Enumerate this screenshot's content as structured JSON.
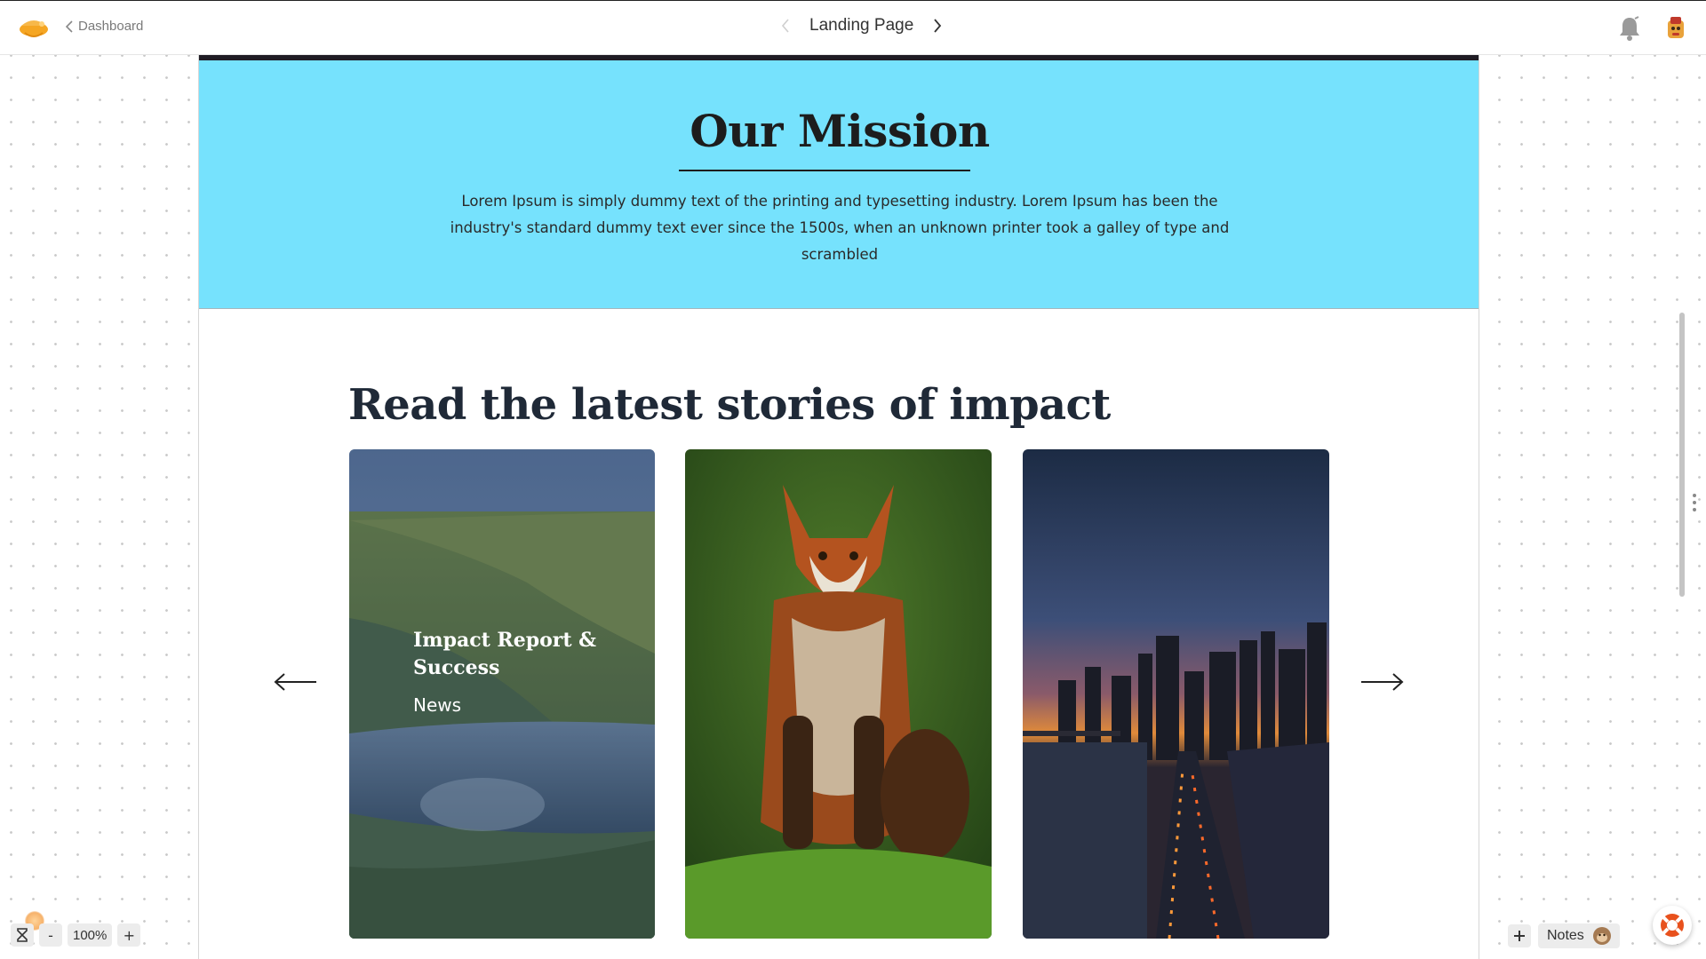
{
  "header": {
    "back_label": "Dashboard",
    "page_title": "Landing Page"
  },
  "mission": {
    "title": "Our Mission",
    "body": "Lorem Ipsum is simply dummy text of the printing and typesetting industry. Lorem Ipsum has been the industry's standard dummy text ever since the 1500s, when an unknown printer took a galley of type and scrambled"
  },
  "stories": {
    "title": "Read the latest stories of impact",
    "cards": [
      {
        "title": "Impact Report & Success",
        "tag": "News",
        "image": "canyon-river-photo"
      },
      {
        "image": "red-fox-photo"
      },
      {
        "image": "city-skyline-sunset-photo"
      }
    ]
  },
  "zoom": {
    "level": "100%",
    "minus": "-",
    "plus": "+"
  },
  "notes": {
    "label": "Notes"
  },
  "colors": {
    "mission_bg": "#76e2fd",
    "heading": "#1f2937",
    "accent_orange": "#f5a623"
  },
  "icons": [
    "logo-icon",
    "chevron-left-icon",
    "chevron-right-icon",
    "bell-icon",
    "avatar-icon",
    "arrow-left-icon",
    "arrow-right-icon",
    "hourglass-icon",
    "plus-icon",
    "monkey-icon",
    "help-lifebuoy-icon"
  ]
}
